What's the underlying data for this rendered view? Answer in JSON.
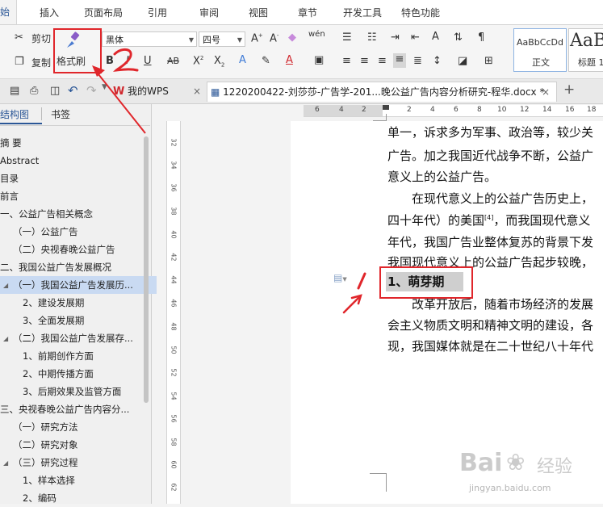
{
  "menubar": {
    "active": "始",
    "items": [
      "插入",
      "页面布局",
      "引用",
      "审阅",
      "视图",
      "章节",
      "开发工具",
      "特色功能"
    ]
  },
  "ribbon": {
    "cut": "剪切",
    "copy": "复制",
    "format_painter": "格式刷",
    "font_name": "黑体",
    "font_size": "四号",
    "style_normal_sample": "AaBbCcDd",
    "style_normal": "正文",
    "style_heading_sample": "AaB",
    "style_heading": "标题 1"
  },
  "tabs": {
    "mywps": "我的WPS",
    "document": "1220200422-刘莎莎-广告学-201...晚公益广告内容分析研究-程华.docx *",
    "add": "+"
  },
  "nav": {
    "tab_outline": "结构图",
    "tab_bookmark": "书签",
    "items": [
      "摘 要",
      "Abstract",
      "目录",
      "前言",
      "一、公益广告相关概念",
      "（一）公益广告",
      "（二）央视春晚公益广告",
      "二、我国公益广告发展概况",
      "（一）我国公益广告发展历...",
      "1、萌芽期",
      "2、建设发展期",
      "3、全面发展期",
      "（二）我国公益广告发展存...",
      "1、前期创作方面",
      "2、中期传播方面",
      "3、后期效果及监管方面",
      "三、央视春晚公益广告内容分...",
      "（一）研究方法",
      "（二）研究对象",
      "（三）研究过程",
      "1、样本选择",
      "2、编码"
    ]
  },
  "hruler": [
    "6",
    "4",
    "2",
    "2",
    "4",
    "6",
    "8",
    "10",
    "12",
    "14",
    "16",
    "18"
  ],
  "vruler": [
    "32",
    "34",
    "36",
    "38",
    "40",
    "42",
    "44",
    "46",
    "48",
    "50",
    "52",
    "54",
    "56",
    "58",
    "60",
    "62"
  ],
  "document": {
    "lines": [
      "单一，诉求多为军事、政治等，较少关",
      "广告。加之我国近代战争不断，公益广",
      "意义上的公益广告。",
      "　　在现代意义上的公益广告历史上，",
      "四十年代）的美国",
      "，而我国现代意义",
      "年代，我国广告业整体复苏的背景下发",
      "我国现代意义上的公益广告起步较晚，",
      "1、萌芽期",
      "　　改革开放后，随着市场经济的发展",
      "会主义物质文明和精神文明的建设，各",
      "现，我国媒体就是在二十世纪八十年代"
    ],
    "footnote": "[4]"
  },
  "annotations": {
    "label1": "1",
    "label2": "2"
  },
  "watermark": {
    "brand": "Bai",
    "brand2": "经验",
    "url": "jingyan.baidu.com"
  },
  "colors": {
    "accent": "#2b5797",
    "annotation_red": "#e0262b",
    "selected_nav": "#c9daf2"
  }
}
